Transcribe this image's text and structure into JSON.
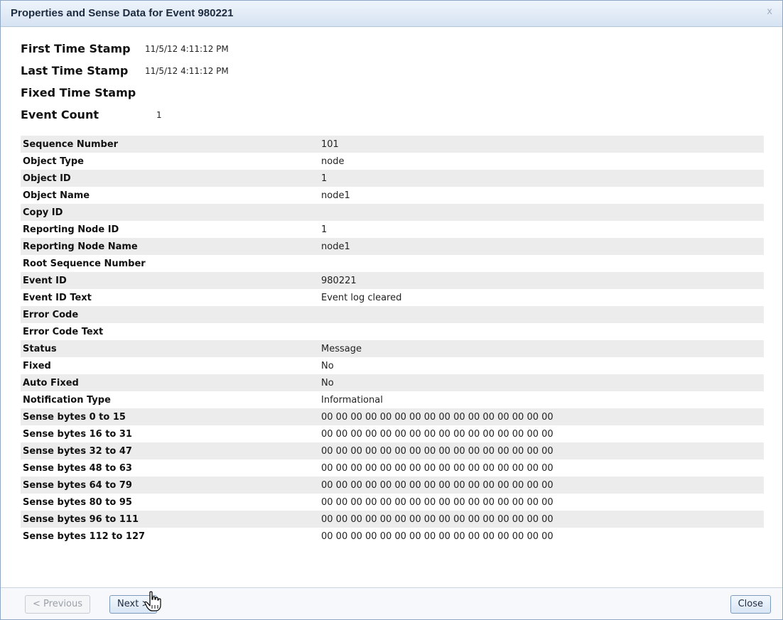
{
  "dialog": {
    "title": "Properties and Sense Data for Event 980221",
    "close_glyph": "x"
  },
  "summary": [
    {
      "label": "First Time Stamp",
      "value": "11/5/12 4:11:12 PM"
    },
    {
      "label": "Last Time Stamp",
      "value": "11/5/12 4:11:12 PM"
    },
    {
      "label": "Fixed Time Stamp",
      "value": ""
    },
    {
      "label": "Event Count",
      "value": "1"
    }
  ],
  "properties": [
    {
      "label": "Sequence Number",
      "value": "101"
    },
    {
      "label": "Object Type",
      "value": "node"
    },
    {
      "label": "Object ID",
      "value": "1"
    },
    {
      "label": "Object Name",
      "value": "node1"
    },
    {
      "label": "Copy ID",
      "value": ""
    },
    {
      "label": "Reporting Node ID",
      "value": "1"
    },
    {
      "label": "Reporting Node Name",
      "value": "node1"
    },
    {
      "label": "Root Sequence Number",
      "value": ""
    },
    {
      "label": "Event ID",
      "value": "980221"
    },
    {
      "label": "Event ID Text",
      "value": "Event log cleared"
    },
    {
      "label": "Error Code",
      "value": ""
    },
    {
      "label": "Error Code Text",
      "value": ""
    },
    {
      "label": "Status",
      "value": "Message"
    },
    {
      "label": "Fixed",
      "value": "No"
    },
    {
      "label": "Auto Fixed",
      "value": "No"
    },
    {
      "label": "Notification Type",
      "value": "Informational"
    },
    {
      "label": "Sense bytes 0 to 15",
      "value": "00 00 00 00 00 00 00 00 00 00 00 00 00 00 00 00"
    },
    {
      "label": "Sense bytes 16 to 31",
      "value": "00 00 00 00 00 00 00 00 00 00 00 00 00 00 00 00"
    },
    {
      "label": "Sense bytes 32 to 47",
      "value": "00 00 00 00 00 00 00 00 00 00 00 00 00 00 00 00"
    },
    {
      "label": "Sense bytes 48 to 63",
      "value": "00 00 00 00 00 00 00 00 00 00 00 00 00 00 00 00"
    },
    {
      "label": "Sense bytes 64 to 79",
      "value": "00 00 00 00 00 00 00 00 00 00 00 00 00 00 00 00"
    },
    {
      "label": "Sense bytes 80 to 95",
      "value": "00 00 00 00 00 00 00 00 00 00 00 00 00 00 00 00"
    },
    {
      "label": "Sense bytes 96 to 111",
      "value": "00 00 00 00 00 00 00 00 00 00 00 00 00 00 00 00"
    },
    {
      "label": "Sense bytes 112 to 127",
      "value": "00 00 00 00 00 00 00 00 00 00 00 00 00 00 00 00"
    }
  ],
  "footer": {
    "previous_label": "< Previous",
    "next_label": "Next >",
    "close_label": "Close"
  },
  "cursor_icon": "hand-pointer-icon"
}
